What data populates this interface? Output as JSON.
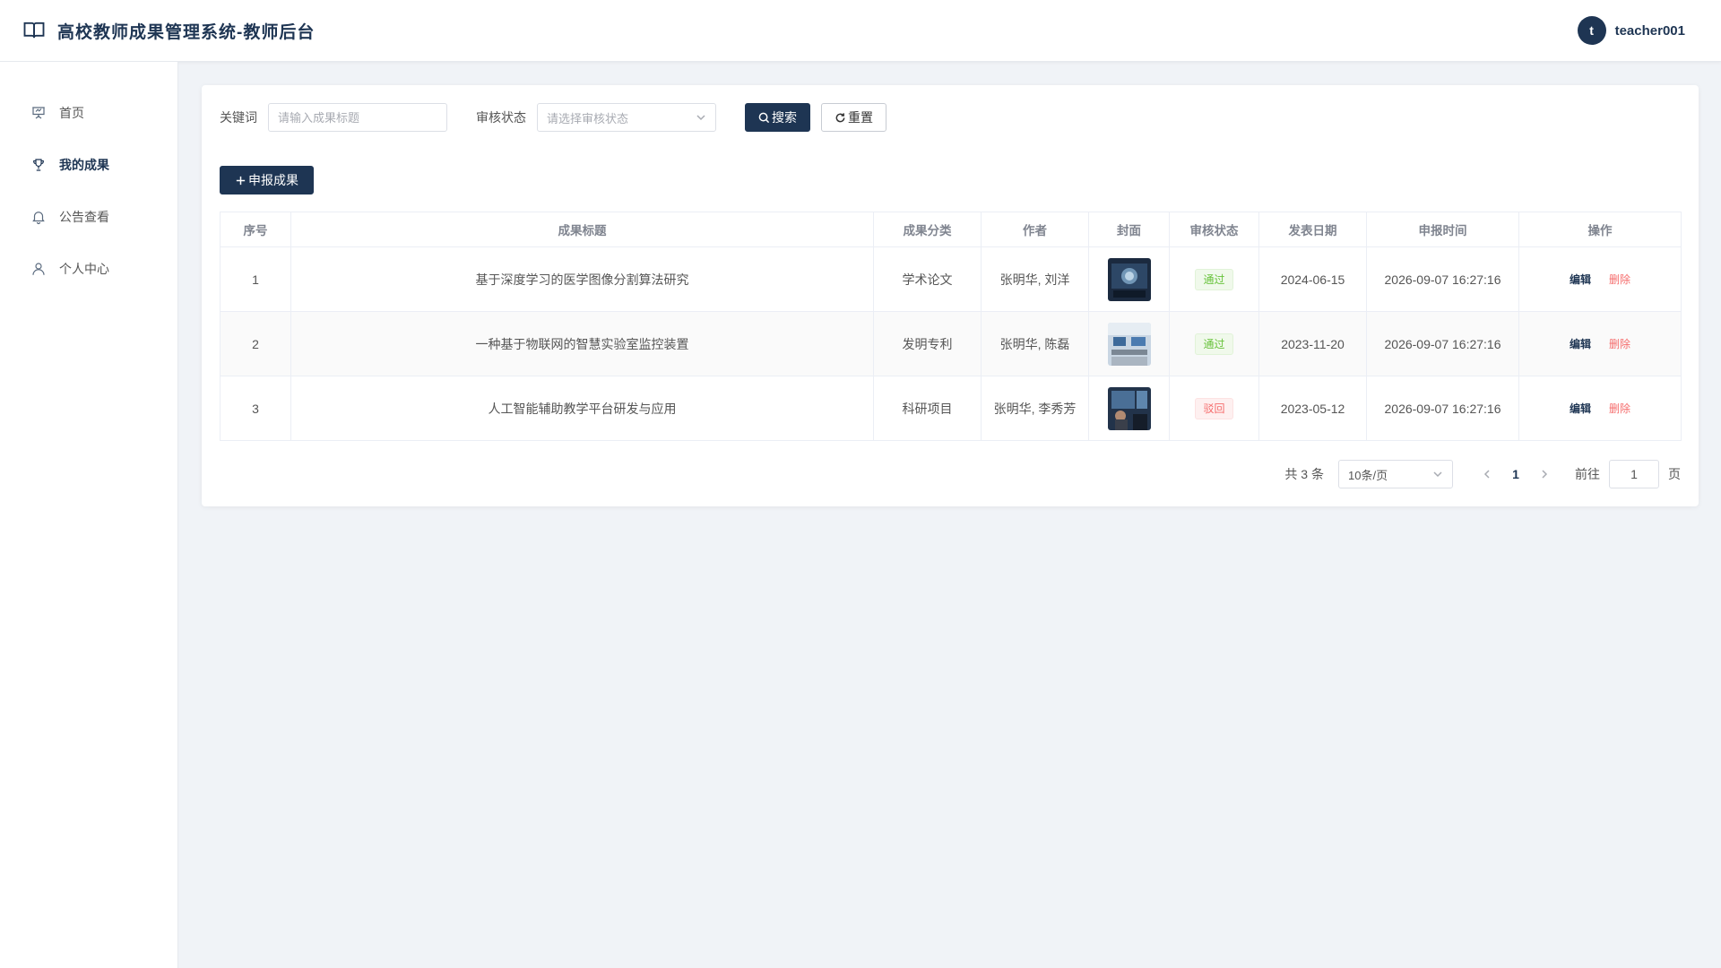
{
  "header": {
    "title": "高校教师成果管理系统-教师后台",
    "avatar_letter": "t",
    "username": "teacher001"
  },
  "sidebar": {
    "items": [
      {
        "label": "首页",
        "icon": "presentation-chart-icon",
        "active": false
      },
      {
        "label": "我的成果",
        "icon": "trophy-icon",
        "active": true
      },
      {
        "label": "公告查看",
        "icon": "bell-icon",
        "active": false
      },
      {
        "label": "个人中心",
        "icon": "user-icon",
        "active": false
      }
    ]
  },
  "filters": {
    "keyword_label": "关键词",
    "keyword_placeholder": "请输入成果标题",
    "status_label": "审核状态",
    "status_placeholder": "请选择审核状态",
    "search_label": "搜索",
    "reset_label": "重置"
  },
  "actions": {
    "add_label": "申报成果"
  },
  "table": {
    "columns": [
      "序号",
      "成果标题",
      "成果分类",
      "作者",
      "封面",
      "审核状态",
      "发表日期",
      "申报时间",
      "操作"
    ],
    "rows": [
      {
        "index": "1",
        "title": "基于深度学习的医学图像分割算法研究",
        "category": "学术论文",
        "authors": "张明华, 刘洋",
        "status": "通过",
        "status_type": "pass",
        "pub_date": "2024-06-15",
        "submit_time": "2026-09-07 16:27:16",
        "edit": "编辑",
        "delete": "删除"
      },
      {
        "index": "2",
        "title": "一种基于物联网的智慧实验室监控装置",
        "category": "发明专利",
        "authors": "张明华, 陈磊",
        "status": "通过",
        "status_type": "pass",
        "pub_date": "2023-11-20",
        "submit_time": "2026-09-07 16:27:16",
        "edit": "编辑",
        "delete": "删除"
      },
      {
        "index": "3",
        "title": "人工智能辅助教学平台研发与应用",
        "category": "科研项目",
        "authors": "张明华, 李秀芳",
        "status": "驳回",
        "status_type": "reject",
        "pub_date": "2023-05-12",
        "submit_time": "2026-09-07 16:27:16",
        "edit": "编辑",
        "delete": "删除"
      }
    ]
  },
  "pagination": {
    "total": "共 3 条",
    "page_size": "10条/页",
    "current_page": "1",
    "goto_label": "前往",
    "goto_value": "1",
    "page_suffix": "页"
  },
  "colors": {
    "primary": "#1e3553",
    "pass": "#67c23a",
    "reject": "#f56c6c",
    "background": "#f0f3f7"
  }
}
